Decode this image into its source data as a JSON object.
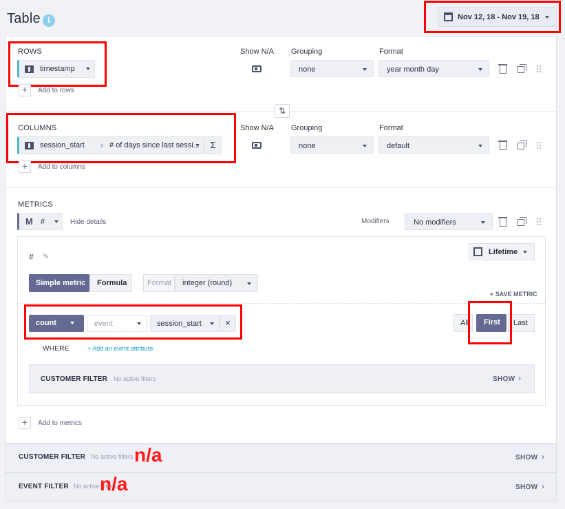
{
  "header": {
    "title": "Table",
    "info_icon": "info-icon",
    "date_range": "Nov 12, 18 - Nov 19, 18"
  },
  "rows": {
    "label": "ROWS",
    "dimension": "timestamp",
    "show_na_label": "Show N/A",
    "grouping_label": "Grouping",
    "grouping_value": "none",
    "format_label": "Format",
    "format_value": "year month day",
    "add_label": "Add to rows"
  },
  "columns": {
    "label": "COLUMNS",
    "dimension_part1": "session_start",
    "separator": "›",
    "dimension_part2": "# of days since last sessi...",
    "sigma": "Σ",
    "show_na_label": "Show N/A",
    "grouping_label": "Grouping",
    "grouping_value": "none",
    "format_label": "Format",
    "format_value": "default",
    "add_label": "Add to columns"
  },
  "swap_icon": "⇅",
  "metrics": {
    "label": "METRICS",
    "metric_icon_letter": "M",
    "metric_name": "#",
    "hide_details": "Hide details",
    "modifiers_label": "Modifiers",
    "modifiers_value": "No modifiers",
    "detail": {
      "name": "#",
      "time_window": "Lifetime",
      "tab_simple": "Simple metric",
      "tab_formula": "Formula",
      "format_label": "Format",
      "format_value": "integer (round)",
      "save_metric": "+ SAVE METRIC",
      "aggregation": "count",
      "event_placeholder": "event",
      "event_value": "session_start",
      "remove": "×",
      "occurrence_all": "All",
      "occurrence_first": "First",
      "occurrence_last": "Last",
      "where_label": "WHERE",
      "add_attribute": "+ Add an event attribute",
      "customer_filter_label": "CUSTOMER FILTER",
      "customer_filter_status": "No active filters",
      "show_label": "SHOW"
    },
    "add_label": "Add to metrics"
  },
  "customer_filter": {
    "label": "CUSTOMER FILTER",
    "status": "No active filters",
    "show": "SHOW",
    "annotation": "n/a"
  },
  "event_filter": {
    "label": "EVENT FILTER",
    "status": "No active filters",
    "show": "SHOW",
    "annotation": "n/a"
  }
}
